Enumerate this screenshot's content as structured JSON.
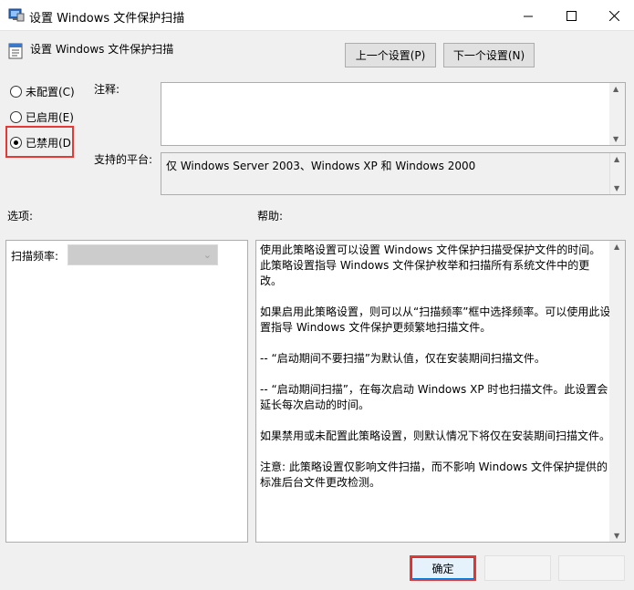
{
  "window": {
    "title": "设置 Windows 文件保护扫描",
    "icon": "policy-settings-icon",
    "controls": [
      "minimize-icon",
      "maximize-icon",
      "close-icon"
    ]
  },
  "header": {
    "policy_title": "设置 Windows 文件保护扫描",
    "prev_label": "上一个设置(P)",
    "next_label": "下一个设置(N)"
  },
  "state": {
    "options": [
      {
        "label": "未配置(C)",
        "selected": false
      },
      {
        "label": "已启用(E)",
        "selected": false
      },
      {
        "label": "已禁用(D",
        "selected": true
      }
    ]
  },
  "comment": {
    "label": "注释:",
    "value": ""
  },
  "platform": {
    "label": "支持的平台:",
    "value": "仅 Windows Server 2003、Windows XP 和 Windows 2000"
  },
  "options_section": {
    "label": "选项:",
    "scan_frequency_label": "扫描频率:",
    "scan_frequency_value": ""
  },
  "help_section": {
    "label": "帮助:",
    "paragraphs": [
      "使用此策略设置可以设置 Windows 文件保护扫描受保护文件的时间。此策略设置指导 Windows 文件保护枚举和扫描所有系统文件中的更改。",
      "如果启用此策略设置，则可以从“扫描频率”框中选择频率。可以使用此设置指导 Windows 文件保护更频繁地扫描文件。",
      "-- “启动期间不要扫描”为默认值，仅在安装期间扫描文件。",
      "-- “启动期间扫描”，在每次启动 Windows XP 时也扫描文件。此设置会延长每次启动的时间。",
      "如果禁用或未配置此策略设置，则默认情况下将仅在安装期间扫描文件。",
      "注意: 此策略设置仅影响文件扫描，而不影响 Windows 文件保护提供的标准后台文件更改检测。"
    ]
  },
  "footer": {
    "ok_label": "确定"
  },
  "colors": {
    "highlight": "#e53935",
    "focus_border": "#0078d7"
  }
}
